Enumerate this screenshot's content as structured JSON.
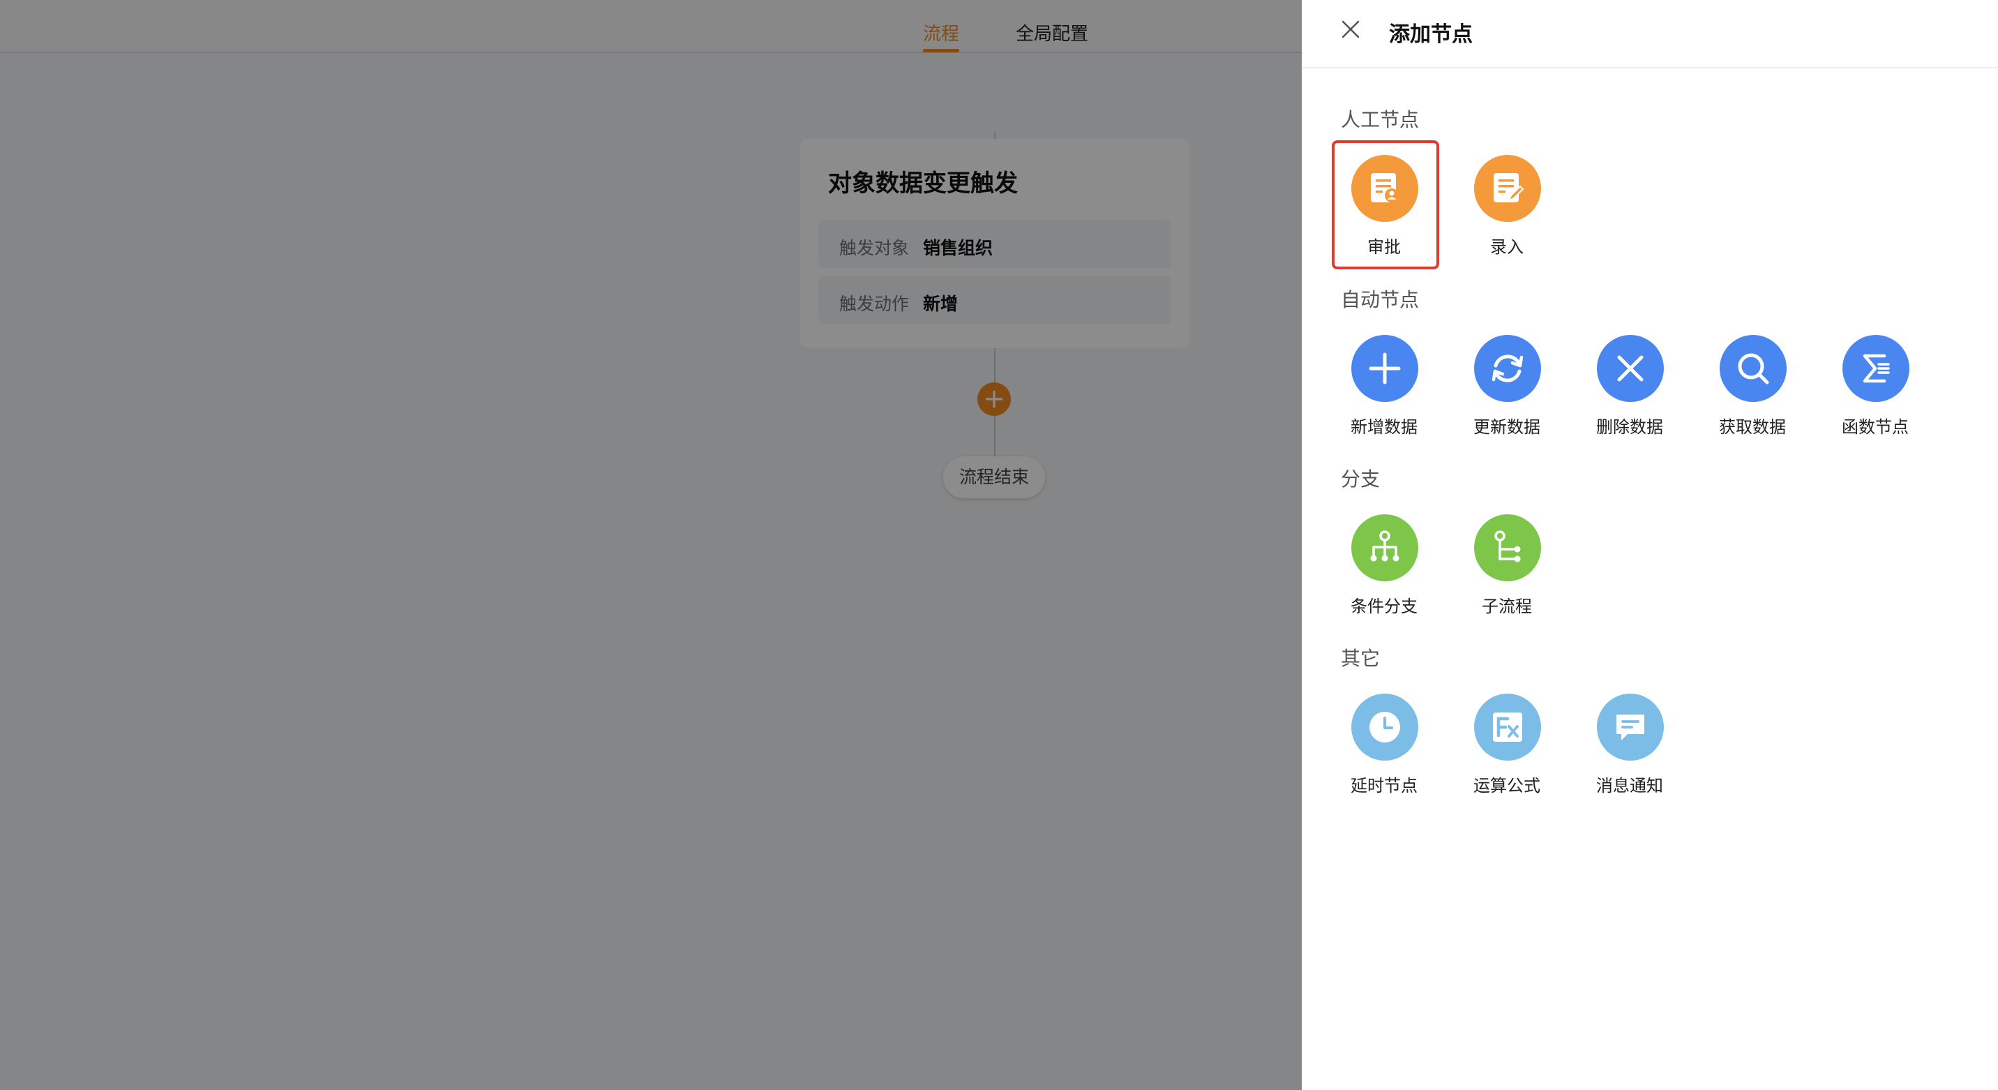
{
  "tabs": [
    {
      "label": "流程",
      "active": true
    },
    {
      "label": "全局配置",
      "active": false
    }
  ],
  "trigger_card": {
    "title": "对象数据变更触发",
    "rows": [
      {
        "label": "触发对象",
        "value": "销售组织"
      },
      {
        "label": "触发动作",
        "value": "新增"
      }
    ]
  },
  "add_button": {
    "symbol": "+"
  },
  "end_node": {
    "label": "流程结束"
  },
  "drawer": {
    "title": "添加节点",
    "sections": [
      {
        "label": "人工节点",
        "nodes": [
          {
            "label": "审批",
            "icon": "approval-icon",
            "color": "#f59a3a"
          },
          {
            "label": "录入",
            "icon": "entry-icon",
            "color": "#f59a3a"
          }
        ]
      },
      {
        "label": "自动节点",
        "nodes": [
          {
            "label": "新增数据",
            "icon": "plus-icon",
            "color": "#4a86f0"
          },
          {
            "label": "更新数据",
            "icon": "refresh-icon",
            "color": "#4a86f0"
          },
          {
            "label": "删除数据",
            "icon": "delete-icon",
            "color": "#4a86f0"
          },
          {
            "label": "获取数据",
            "icon": "search-icon",
            "color": "#4a86f0"
          },
          {
            "label": "函数节点",
            "icon": "sigma-icon",
            "color": "#4a86f0"
          }
        ]
      },
      {
        "label": "分支",
        "nodes": [
          {
            "label": "条件分支",
            "icon": "branch-icon",
            "color": "#7dc64a"
          },
          {
            "label": "子流程",
            "icon": "subprocess-icon",
            "color": "#7dc64a"
          }
        ]
      },
      {
        "label": "其它",
        "nodes": [
          {
            "label": "延时节点",
            "icon": "clock-icon",
            "color": "#7cbde8"
          },
          {
            "label": "运算公式",
            "icon": "formula-icon",
            "color": "#7cbde8"
          },
          {
            "label": "消息通知",
            "icon": "message-icon",
            "color": "#7cbde8"
          }
        ]
      }
    ]
  },
  "colors": {
    "accent": "#f08a24",
    "highlight": "#e23a2e"
  }
}
